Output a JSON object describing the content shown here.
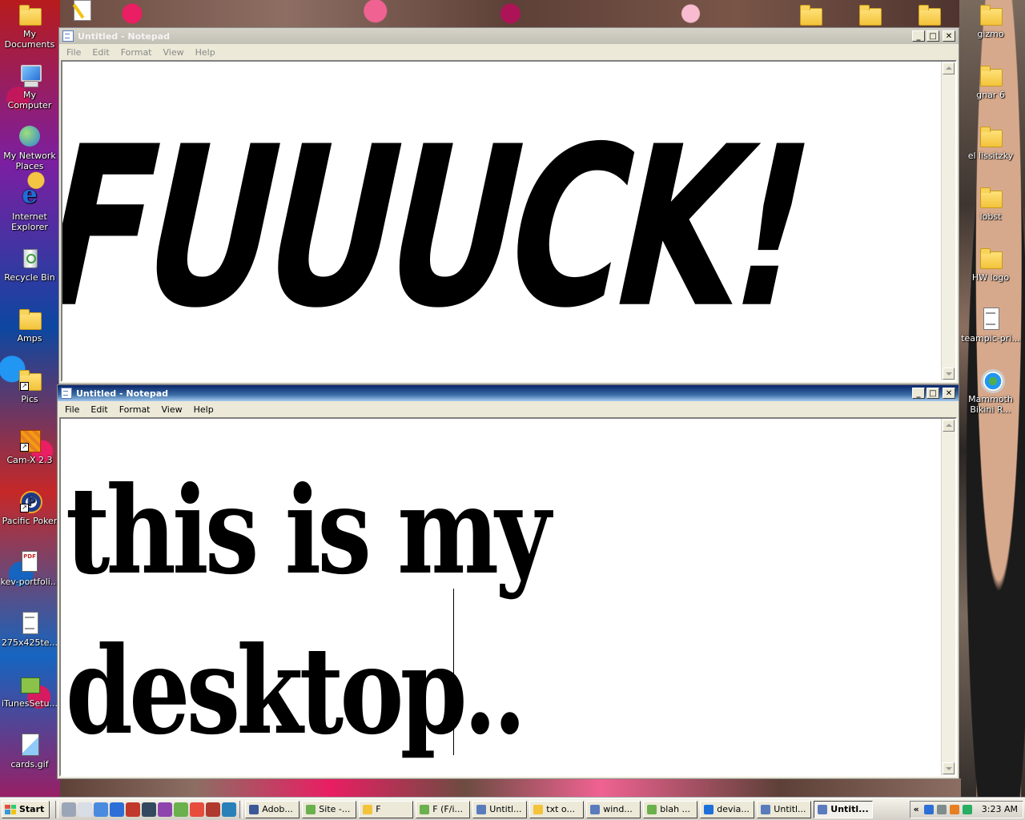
{
  "desktop": {
    "left_icons": [
      {
        "label": "My Documents",
        "icon": "folder-documents-icon"
      },
      {
        "label": "My Computer",
        "icon": "computer-icon"
      },
      {
        "label": "My Network Places",
        "icon": "network-icon"
      },
      {
        "label": "Internet Explorer",
        "icon": "internet-explorer-icon"
      },
      {
        "label": "Recycle Bin",
        "icon": "recycle-bin-icon"
      },
      {
        "label": "Amps",
        "icon": "folder-icon"
      },
      {
        "label": "Pics",
        "icon": "folder-shortcut-icon"
      },
      {
        "label": "Cam-X 2.3",
        "icon": "app-shortcut-icon"
      },
      {
        "label": "Pacific Poker",
        "icon": "poker-icon"
      },
      {
        "label": "kev-portfoli...",
        "icon": "pdf-icon"
      },
      {
        "label": "275x425te...",
        "icon": "text-document-icon"
      },
      {
        "label": "iTunesSetu...",
        "icon": "installer-icon"
      },
      {
        "label": "cards.gif",
        "icon": "image-file-icon"
      }
    ],
    "right_icons": [
      {
        "label": "gizmo",
        "icon": "folder-icon"
      },
      {
        "label": "gnar 6",
        "icon": "folder-icon"
      },
      {
        "label": "el lissitzky",
        "icon": "folder-icon"
      },
      {
        "label": "lobst",
        "icon": "folder-icon"
      },
      {
        "label": "HW logo",
        "icon": "folder-icon"
      },
      {
        "label": "teampic-pri...",
        "icon": "image-file-icon"
      },
      {
        "label": "Mammoth Bikini R...",
        "icon": "quicktime-icon"
      }
    ]
  },
  "window1": {
    "title": "Untitled - Notepad",
    "menu": [
      "File",
      "Edit",
      "Format",
      "View",
      "Help"
    ],
    "content": "FUUUCK!"
  },
  "window2": {
    "title": "Untitled - Notepad",
    "menu": [
      "File",
      "Edit",
      "Format",
      "View",
      "Help"
    ],
    "content": "this is my desktop.."
  },
  "taskbar": {
    "start_label": "Start",
    "tasks": [
      {
        "label": "Adob...",
        "icon": "adobe-icon",
        "color": "#3b5998"
      },
      {
        "label": "Site -...",
        "icon": "dreamweaver-icon",
        "color": "#6ab04c"
      },
      {
        "label": "F",
        "icon": "folder-icon",
        "color": "#f3c33a"
      },
      {
        "label": "F (F/i...",
        "icon": "dreamweaver-icon",
        "color": "#6ab04c"
      },
      {
        "label": "Untitl...",
        "icon": "notepad-icon",
        "color": "#5a7cbd"
      },
      {
        "label": "txt o...",
        "icon": "folder-icon",
        "color": "#f3c33a"
      },
      {
        "label": "wind...",
        "icon": "notepad-icon",
        "color": "#5a7cbd"
      },
      {
        "label": "blah ...",
        "icon": "dreamweaver-icon",
        "color": "#6ab04c"
      },
      {
        "label": "devia...",
        "icon": "internet-explorer-icon",
        "color": "#1e6fd9"
      },
      {
        "label": "Untitl...",
        "icon": "notepad-icon",
        "color": "#5a7cbd"
      },
      {
        "label": "Untitl...",
        "icon": "notepad-icon",
        "color": "#5a7cbd",
        "active": true
      }
    ],
    "clock": "3:23 AM"
  }
}
